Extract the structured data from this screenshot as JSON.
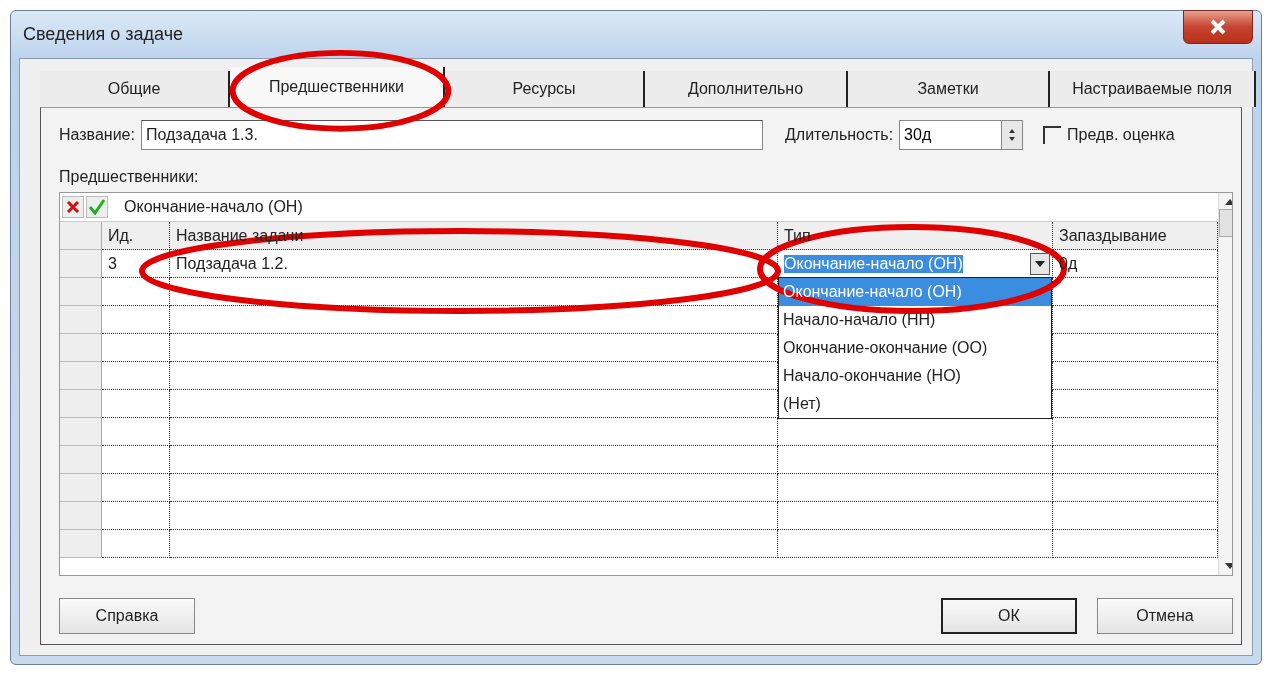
{
  "window": {
    "title": "Сведения о задаче"
  },
  "tabs": [
    {
      "label": "Общие",
      "selected": false
    },
    {
      "label": "Предшественники",
      "selected": true
    },
    {
      "label": "Ресурсы",
      "selected": false
    },
    {
      "label": "Дополнительно",
      "selected": false
    },
    {
      "label": "Заметки",
      "selected": false
    },
    {
      "label": "Настраиваемые поля",
      "selected": false
    }
  ],
  "name_field": {
    "label": "Название:",
    "value": "Подзадача 1.3."
  },
  "duration_field": {
    "label": "Длительность:",
    "value": "30д"
  },
  "estimate_checkbox": {
    "label": "Предв. оценка",
    "checked": false
  },
  "predecessors_label": "Предшественники:",
  "entry_bar": {
    "value": "Окончание-начало (ОН)"
  },
  "table": {
    "columns": [
      "Ид.",
      "Название задачи",
      "Тип",
      "Запаздывание"
    ],
    "rows": [
      {
        "id": "3",
        "name": "Подзадача 1.2.",
        "type": "Окончание-начало (ОН)",
        "lag": "0д"
      }
    ]
  },
  "type_dropdown": {
    "options": [
      {
        "label": "Окончание-начало (ОН)",
        "selected": true
      },
      {
        "label": "Начало-начало (НН)",
        "selected": false
      },
      {
        "label": "Окончание-окончание (ОО)",
        "selected": false
      },
      {
        "label": "Начало-окончание (НО)",
        "selected": false
      },
      {
        "label": "(Нет)",
        "selected": false
      }
    ]
  },
  "buttons": [
    {
      "label": "Справка",
      "default": false
    },
    {
      "label": "ОК",
      "default": true
    },
    {
      "label": "Отмена",
      "default": false
    }
  ]
}
